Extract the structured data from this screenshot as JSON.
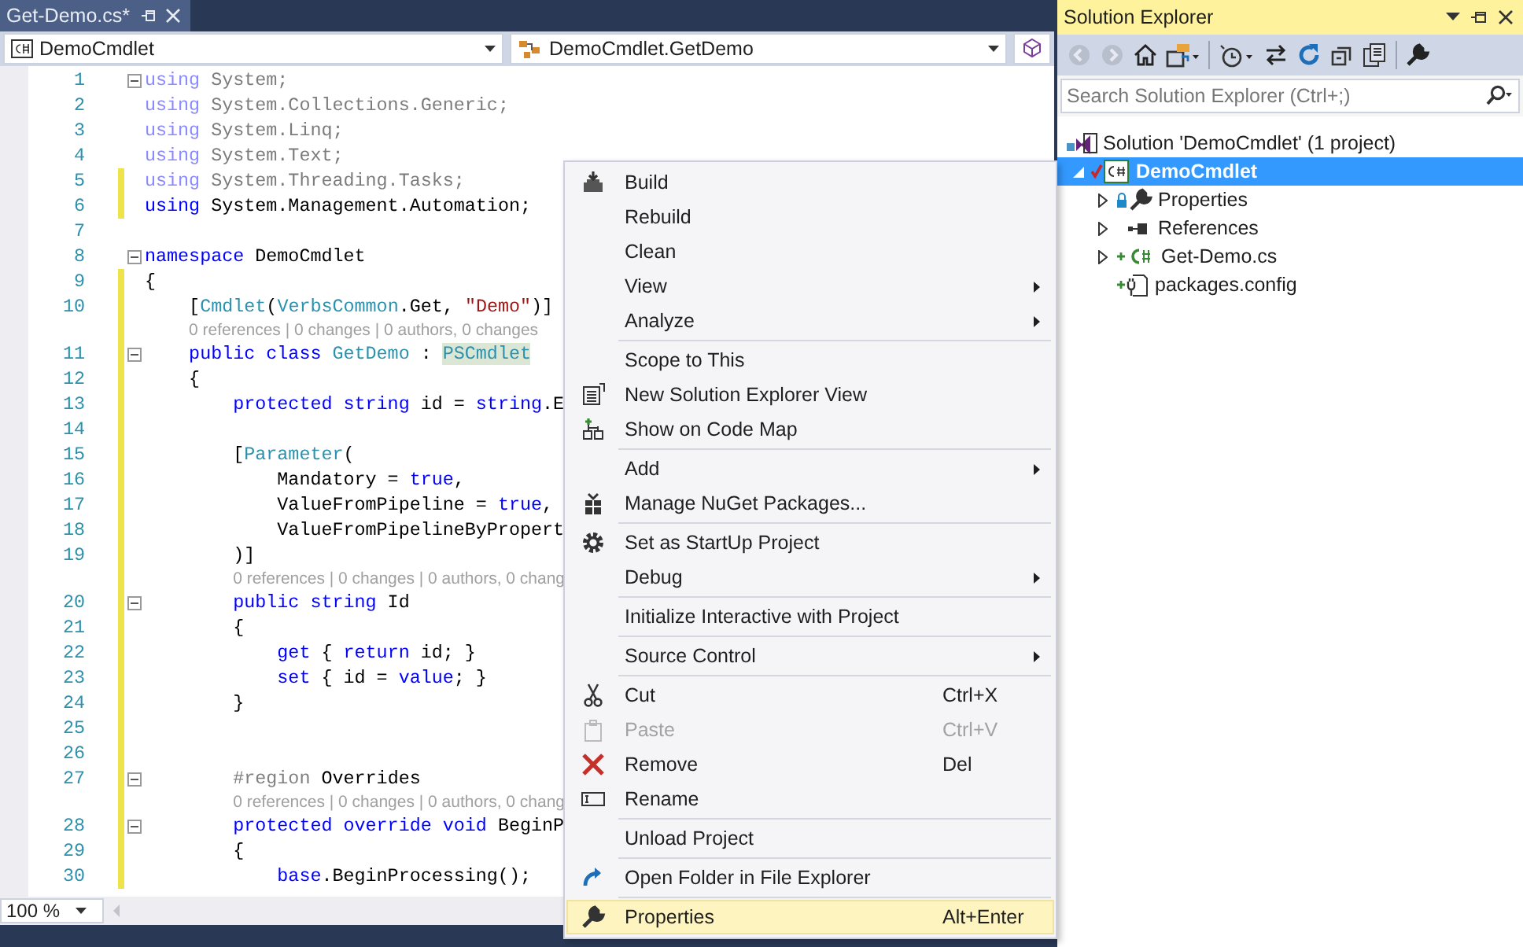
{
  "document_tab": {
    "title": "Get-Demo.cs*",
    "selected": true
  },
  "navigation": {
    "project": "DemoCmdlet",
    "type": "DemoCmdlet.GetDemo"
  },
  "code": [
    {
      "kind": "code",
      "number": "1",
      "changed": false,
      "fold": true,
      "faded": true,
      "tokens": [
        {
          "kind": "keyword",
          "text": "using"
        },
        {
          "kind": "text",
          "text": " System;"
        }
      ]
    },
    {
      "kind": "code",
      "number": "2",
      "changed": false,
      "fold": false,
      "faded": true,
      "tokens": [
        {
          "kind": "keyword",
          "text": "using"
        },
        {
          "kind": "text",
          "text": " System.Collections.Generic;"
        }
      ]
    },
    {
      "kind": "code",
      "number": "3",
      "changed": false,
      "fold": false,
      "faded": true,
      "tokens": [
        {
          "kind": "keyword",
          "text": "using"
        },
        {
          "kind": "text",
          "text": " System.Linq;"
        }
      ]
    },
    {
      "kind": "code",
      "number": "4",
      "changed": false,
      "fold": false,
      "faded": true,
      "tokens": [
        {
          "kind": "keyword",
          "text": "using"
        },
        {
          "kind": "text",
          "text": " System.Text;"
        }
      ]
    },
    {
      "kind": "code",
      "number": "5",
      "changed": true,
      "fold": false,
      "faded": true,
      "tokens": [
        {
          "kind": "keyword",
          "text": "using"
        },
        {
          "kind": "text",
          "text": " System.Threading.Tasks;"
        }
      ]
    },
    {
      "kind": "code",
      "number": "6",
      "changed": true,
      "fold": false,
      "faded": false,
      "tokens": [
        {
          "kind": "keyword",
          "text": "using"
        },
        {
          "kind": "text",
          "text": " System.Management.Automation;"
        }
      ]
    },
    {
      "kind": "code",
      "number": "7",
      "changed": false,
      "fold": false
    },
    {
      "kind": "code",
      "number": "8",
      "changed": false,
      "fold": true,
      "faded": false,
      "tokens": [
        {
          "kind": "keyword",
          "text": "namespace"
        },
        {
          "kind": "text",
          "text": " DemoCmdlet"
        }
      ]
    },
    {
      "kind": "code",
      "number": "9",
      "changed": true,
      "fold": false,
      "faded": false,
      "tokens": [
        {
          "kind": "text",
          "text": "{"
        }
      ]
    },
    {
      "kind": "code",
      "number": "10",
      "changed": true,
      "fold": false,
      "faded": false,
      "tokens": [
        {
          "kind": "text",
          "text": "    ["
        },
        {
          "kind": "type",
          "text": "Cmdlet"
        },
        {
          "kind": "text",
          "text": "("
        },
        {
          "kind": "type",
          "text": "VerbsCommon"
        },
        {
          "kind": "text",
          "text": ".Get, "
        },
        {
          "kind": "string",
          "text": "\"Demo\""
        },
        {
          "kind": "text",
          "text": ")]"
        }
      ]
    },
    {
      "kind": "lens",
      "changed": true,
      "text": "0 references | 0 changes | 0 authors, 0 changes"
    },
    {
      "kind": "code",
      "number": "11",
      "changed": true,
      "fold": true,
      "faded": false,
      "tokens": [
        {
          "kind": "keyword",
          "text": "    public class"
        },
        {
          "kind": "type",
          "text": " GetDemo"
        },
        {
          "kind": "text",
          "text": " : "
        },
        {
          "kind": "match",
          "text": "PSCmdlet"
        }
      ]
    },
    {
      "kind": "code",
      "number": "12",
      "changed": true,
      "fold": false,
      "faded": false,
      "tokens": [
        {
          "kind": "text",
          "text": "    {"
        }
      ]
    },
    {
      "kind": "code",
      "number": "13",
      "changed": true,
      "fold": false,
      "faded": false,
      "tokens": [
        {
          "kind": "keyword",
          "text": "        protected string"
        },
        {
          "kind": "text",
          "text": " id = "
        },
        {
          "kind": "keyword",
          "text": "string"
        },
        {
          "kind": "text",
          "text": ".E"
        }
      ]
    },
    {
      "kind": "code",
      "number": "14",
      "changed": true,
      "fold": false
    },
    {
      "kind": "code",
      "number": "15",
      "changed": true,
      "fold": false,
      "faded": false,
      "tokens": [
        {
          "kind": "text",
          "text": "        ["
        },
        {
          "kind": "type",
          "text": "Parameter"
        },
        {
          "kind": "text",
          "text": "("
        }
      ]
    },
    {
      "kind": "code",
      "number": "16",
      "changed": true,
      "fold": false,
      "faded": false,
      "tokens": [
        {
          "kind": "text",
          "text": "            Mandatory = "
        },
        {
          "kind": "keyword",
          "text": "true"
        },
        {
          "kind": "text",
          "text": ","
        }
      ]
    },
    {
      "kind": "code",
      "number": "17",
      "changed": true,
      "fold": false,
      "faded": false,
      "tokens": [
        {
          "kind": "text",
          "text": "            ValueFromPipeline = "
        },
        {
          "kind": "keyword",
          "text": "true"
        },
        {
          "kind": "text",
          "text": ","
        }
      ]
    },
    {
      "kind": "code",
      "number": "18",
      "changed": true,
      "fold": false,
      "faded": false,
      "tokens": [
        {
          "kind": "text",
          "text": "            ValueFromPipelineByPropert"
        }
      ]
    },
    {
      "kind": "code",
      "number": "19",
      "changed": true,
      "fold": false,
      "faded": false,
      "tokens": [
        {
          "kind": "text",
          "text": "        )]"
        }
      ]
    },
    {
      "kind": "lens",
      "changed": true,
      "text": "0 references | 0 changes | 0 authors, 0 chang"
    },
    {
      "kind": "code",
      "number": "20",
      "changed": true,
      "fold": true,
      "faded": false,
      "tokens": [
        {
          "kind": "keyword",
          "text": "        public string"
        },
        {
          "kind": "text",
          "text": " Id"
        }
      ]
    },
    {
      "kind": "code",
      "number": "21",
      "changed": true,
      "fold": false,
      "faded": false,
      "tokens": [
        {
          "kind": "text",
          "text": "        {"
        }
      ]
    },
    {
      "kind": "code",
      "number": "22",
      "changed": true,
      "fold": false,
      "faded": false,
      "tokens": [
        {
          "kind": "keyword",
          "text": "            get"
        },
        {
          "kind": "text",
          "text": " { "
        },
        {
          "kind": "keyword",
          "text": "return"
        },
        {
          "kind": "text",
          "text": " id; }"
        }
      ]
    },
    {
      "kind": "code",
      "number": "23",
      "changed": true,
      "fold": false,
      "faded": false,
      "tokens": [
        {
          "kind": "keyword",
          "text": "            set"
        },
        {
          "kind": "text",
          "text": " { id = "
        },
        {
          "kind": "keyword",
          "text": "value"
        },
        {
          "kind": "text",
          "text": "; }"
        }
      ]
    },
    {
      "kind": "code",
      "number": "24",
      "changed": true,
      "fold": false,
      "faded": false,
      "tokens": [
        {
          "kind": "text",
          "text": "        }"
        }
      ]
    },
    {
      "kind": "code",
      "number": "25",
      "changed": true,
      "fold": false
    },
    {
      "kind": "code",
      "number": "26",
      "changed": true,
      "fold": false
    },
    {
      "kind": "code",
      "number": "27",
      "changed": true,
      "fold": true,
      "faded": false,
      "tokens": [
        {
          "kind": "directive",
          "text": "        #region"
        },
        {
          "kind": "text",
          "text": " Overrides"
        }
      ]
    },
    {
      "kind": "lens",
      "changed": true,
      "text": "0 references | 0 changes | 0 authors, 0 chang"
    },
    {
      "kind": "code",
      "number": "28",
      "changed": true,
      "fold": true,
      "faded": false,
      "tokens": [
        {
          "kind": "keyword",
          "text": "        protected override void"
        },
        {
          "kind": "text",
          "text": " BeginP"
        }
      ]
    },
    {
      "kind": "code",
      "number": "29",
      "changed": true,
      "fold": false,
      "faded": false,
      "tokens": [
        {
          "kind": "text",
          "text": "        {"
        }
      ]
    },
    {
      "kind": "code",
      "number": "30",
      "changed": true,
      "fold": false,
      "faded": false,
      "tokens": [
        {
          "kind": "keyword",
          "text": "            base"
        },
        {
          "kind": "text",
          "text": ".BeginProcessing();"
        }
      ]
    }
  ],
  "zoom": "100 %",
  "context_menu": [
    {
      "kind": "item",
      "label": "Build",
      "submenu": false,
      "disabled": false,
      "selected": false
    },
    {
      "kind": "item",
      "label": "Rebuild",
      "submenu": false,
      "disabled": false,
      "selected": false
    },
    {
      "kind": "item",
      "label": "Clean",
      "submenu": false,
      "disabled": false,
      "selected": false
    },
    {
      "kind": "item",
      "label": "View",
      "submenu": true,
      "disabled": false,
      "selected": false
    },
    {
      "kind": "item",
      "label": "Analyze",
      "submenu": true,
      "disabled": false,
      "selected": false
    },
    {
      "kind": "separator"
    },
    {
      "kind": "item",
      "label": "Scope to This",
      "submenu": false,
      "disabled": false,
      "selected": false
    },
    {
      "kind": "item",
      "label": "New Solution Explorer View",
      "submenu": false,
      "disabled": false,
      "selected": false
    },
    {
      "kind": "item",
      "label": "Show on Code Map",
      "submenu": false,
      "disabled": false,
      "selected": false
    },
    {
      "kind": "separator"
    },
    {
      "kind": "item",
      "label": "Add",
      "submenu": true,
      "disabled": false,
      "selected": false
    },
    {
      "kind": "item",
      "label": "Manage NuGet Packages...",
      "submenu": false,
      "disabled": false,
      "selected": false
    },
    {
      "kind": "separator"
    },
    {
      "kind": "item",
      "label": "Set as StartUp Project",
      "submenu": false,
      "disabled": false,
      "selected": false
    },
    {
      "kind": "item",
      "label": "Debug",
      "submenu": true,
      "disabled": false,
      "selected": false
    },
    {
      "kind": "separator"
    },
    {
      "kind": "item",
      "label": "Initialize Interactive with Project",
      "submenu": false,
      "disabled": false,
      "selected": false
    },
    {
      "kind": "separator"
    },
    {
      "kind": "item",
      "label": "Source Control",
      "submenu": true,
      "disabled": false,
      "selected": false
    },
    {
      "kind": "separator"
    },
    {
      "kind": "item",
      "label": "Cut",
      "shortcut": "Ctrl+X",
      "submenu": false,
      "disabled": false,
      "selected": false
    },
    {
      "kind": "item",
      "label": "Paste",
      "shortcut": "Ctrl+V",
      "submenu": false,
      "disabled": true,
      "selected": false
    },
    {
      "kind": "item",
      "label": "Remove",
      "shortcut": "Del",
      "submenu": false,
      "disabled": false,
      "selected": false
    },
    {
      "kind": "item",
      "label": "Rename",
      "submenu": false,
      "disabled": false,
      "selected": false
    },
    {
      "kind": "separator"
    },
    {
      "kind": "item",
      "label": "Unload Project",
      "submenu": false,
      "disabled": false,
      "selected": false
    },
    {
      "kind": "separator"
    },
    {
      "kind": "item",
      "label": "Open Folder in File Explorer",
      "submenu": false,
      "disabled": false,
      "selected": false
    },
    {
      "kind": "separator"
    },
    {
      "kind": "item",
      "label": "Properties",
      "shortcut": "Alt+Enter",
      "submenu": false,
      "disabled": false,
      "selected": true
    }
  ],
  "solution_explorer": {
    "title": "Solution Explorer",
    "search": {
      "placeholder": "Search Solution Explorer (Ctrl+;)"
    },
    "tree": [
      {
        "label": "Solution 'DemoCmdlet' (1 project)",
        "selected": false,
        "children": [
          {
            "label": "DemoCmdlet",
            "selected": true,
            "expanded": true,
            "children": [
              {
                "label": "Properties",
                "selected": false,
                "expanded": false
              },
              {
                "label": "References",
                "selected": false,
                "expanded": false
              },
              {
                "label": "Get-Demo.cs",
                "selected": false,
                "expanded": false
              },
              {
                "label": "packages.config",
                "selected": false
              }
            ]
          }
        ]
      }
    ]
  }
}
